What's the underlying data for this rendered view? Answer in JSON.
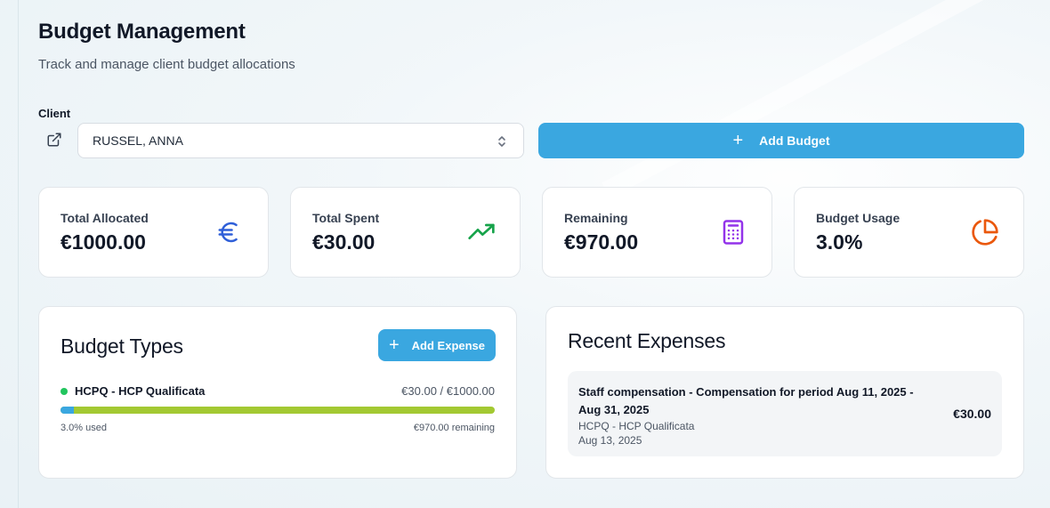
{
  "header": {
    "title": "Budget Management",
    "subtitle": "Track and manage client budget allocations"
  },
  "client": {
    "label": "Client",
    "selected": "RUSSEL, ANNA"
  },
  "actions": {
    "add_budget_label": "Add Budget",
    "add_expense_label": "Add Expense"
  },
  "stats": [
    {
      "label": "Total Allocated",
      "value": "€1000.00",
      "icon": "euro-icon",
      "color": "#2f5fd8"
    },
    {
      "label": "Total Spent",
      "value": "€30.00",
      "icon": "trending-up-icon",
      "color": "#16a34a"
    },
    {
      "label": "Remaining",
      "value": "€970.00",
      "icon": "calculator-icon",
      "color": "#9333ea"
    },
    {
      "label": "Budget Usage",
      "value": "3.0%",
      "icon": "pie-chart-icon",
      "color": "#ea580c"
    }
  ],
  "budget_types": {
    "title": "Budget Types",
    "items": [
      {
        "name": "HCPQ - HCP Qualificata",
        "amount": "€30.00 / €1000.00",
        "used_label": "3.0% used",
        "remaining_label": "€970.00 remaining",
        "used_fraction": 0.03,
        "status_color": "#22c55e"
      }
    ]
  },
  "recent_expenses": {
    "title": "Recent Expenses",
    "items": [
      {
        "description": "Staff compensation - Compensation for period Aug 11, 2025 - Aug 31, 2025",
        "budget_type": "HCPQ - HCP Qualificata",
        "date": "Aug 13, 2025",
        "amount": "€30.00"
      }
    ]
  },
  "colors": {
    "accent": "#3aa7e0",
    "progress_track": "#a3c932"
  }
}
